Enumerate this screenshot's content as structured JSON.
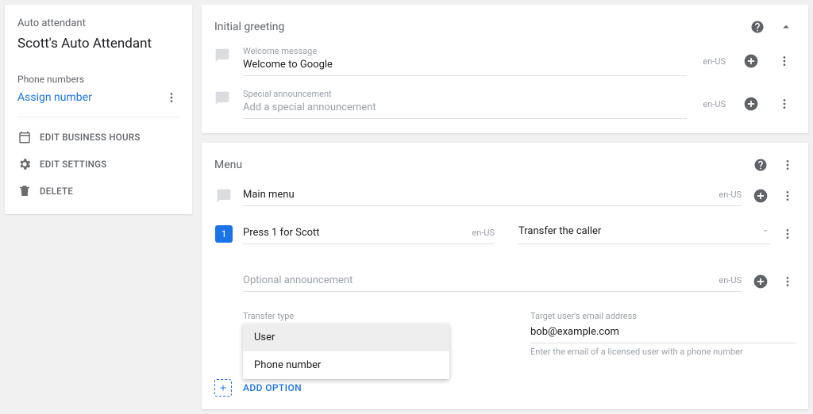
{
  "sidebar": {
    "label": "Auto attendant",
    "title": "Scott's Auto Attendant",
    "phone_label": "Phone numbers",
    "assign_link": "Assign number",
    "actions": {
      "hours": "EDIT BUSINESS HOURS",
      "settings": "EDIT SETTINGS",
      "delete": "DELETE"
    }
  },
  "greeting": {
    "title": "Initial greeting",
    "welcome_label": "Welcome message",
    "welcome_value": "Welcome to Google",
    "welcome_locale": "en-US",
    "special_label": "Special announcement",
    "special_placeholder": "Add a special announcement",
    "special_locale": "en-US"
  },
  "menu": {
    "title": "Menu",
    "main_label": "Main menu",
    "main_locale": "en-US",
    "key1": "1",
    "press_text": "Press 1 for Scott",
    "press_locale": "en-US",
    "action_text": "Transfer the caller",
    "optional_placeholder": "Optional announcement",
    "optional_locale": "en-US",
    "transfer_label": "Transfer type",
    "transfer_opts": {
      "user": "User",
      "phone": "Phone number"
    },
    "target_label": "Target user's email address",
    "target_value": "bob@example.com",
    "target_hint": "Enter the email of a licensed user with a phone number",
    "add_option": "ADD OPTION"
  }
}
